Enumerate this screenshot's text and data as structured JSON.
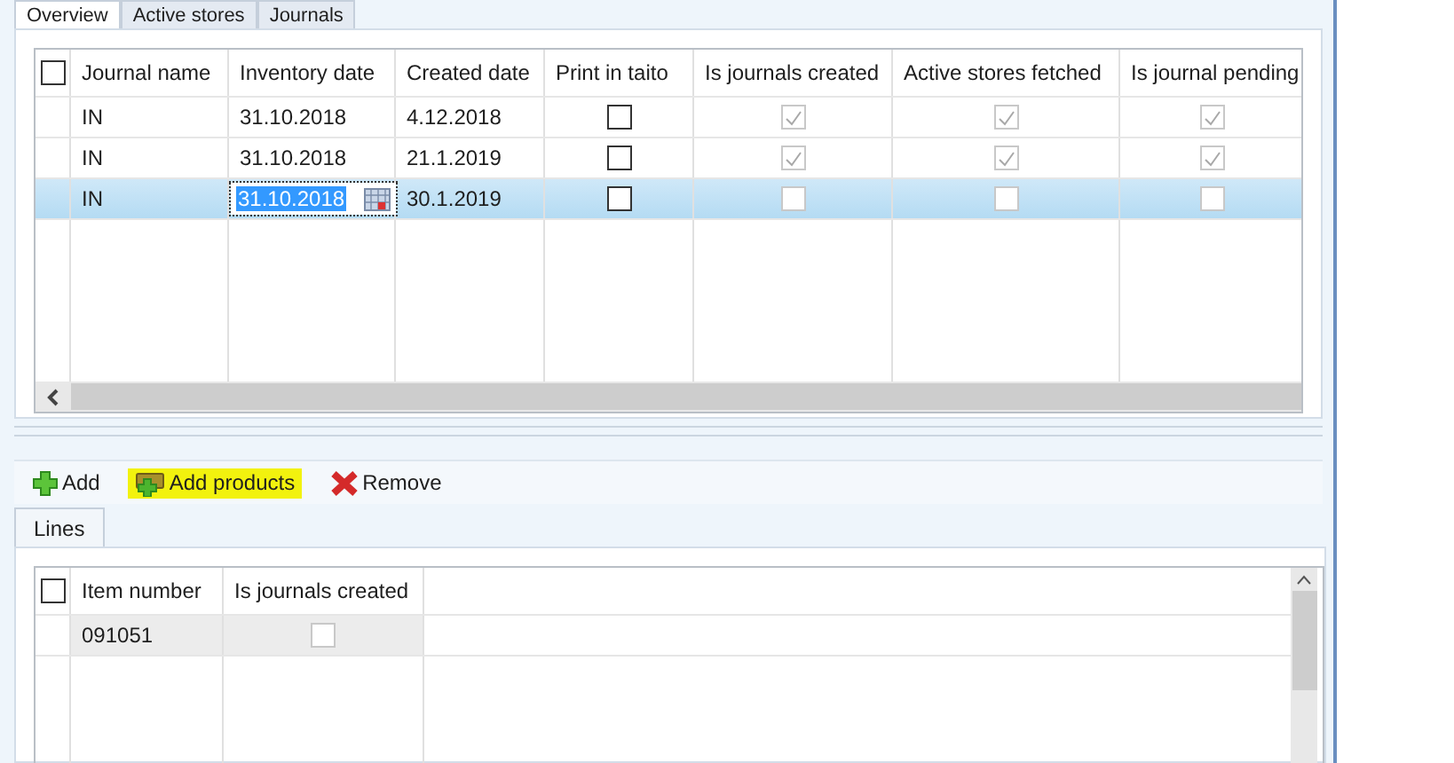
{
  "tabs": [
    {
      "label": "Overview",
      "selected": true
    },
    {
      "label": "Active stores",
      "selected": false
    },
    {
      "label": "Journals",
      "selected": false
    }
  ],
  "top_grid": {
    "select_all_checked": false,
    "columns": [
      {
        "label": "Journal name",
        "kind": "text"
      },
      {
        "label": "Inventory date",
        "kind": "text"
      },
      {
        "label": "Created date",
        "kind": "text"
      },
      {
        "label": "Print in taito",
        "kind": "checkbox"
      },
      {
        "label": "Is journals created",
        "kind": "readonly-checkbox"
      },
      {
        "label": "Active stores fetched",
        "kind": "readonly-checkbox"
      },
      {
        "label": "Is journal pending",
        "kind": "readonly-checkbox"
      }
    ],
    "rows": [
      {
        "selected": false,
        "cells": [
          {
            "text": "IN"
          },
          {
            "text": "31.10.2018"
          },
          {
            "text": "4.12.2018"
          },
          {
            "checked": false
          },
          {
            "checked": true
          },
          {
            "checked": true
          },
          {
            "checked": true
          }
        ]
      },
      {
        "selected": false,
        "cells": [
          {
            "text": "IN"
          },
          {
            "text": "31.10.2018"
          },
          {
            "text": "21.1.2019"
          },
          {
            "checked": false
          },
          {
            "checked": true
          },
          {
            "checked": true
          },
          {
            "checked": true
          }
        ]
      },
      {
        "selected": true,
        "cells": [
          {
            "text": "IN"
          },
          {
            "text": "31.10.2018",
            "editing": true
          },
          {
            "text": "30.1.2019"
          },
          {
            "checked": false
          },
          {
            "checked": false
          },
          {
            "checked": false
          },
          {
            "checked": false
          }
        ]
      }
    ]
  },
  "toolbar": [
    {
      "label": "Add",
      "kind": "add",
      "highlighted": false
    },
    {
      "label": "Add products",
      "kind": "add-products",
      "highlighted": true
    },
    {
      "label": "Remove",
      "kind": "remove",
      "highlighted": false
    }
  ],
  "lines_tabs": [
    {
      "label": "Lines",
      "selected": true
    }
  ],
  "lines_grid": {
    "select_all_checked": false,
    "columns": [
      {
        "label": "Item number",
        "kind": "text"
      },
      {
        "label": "Is journals created",
        "kind": "readonly-checkbox"
      }
    ],
    "rows": [
      {
        "selected": true,
        "cells": [
          {
            "text": "091051"
          },
          {
            "checked": false
          }
        ]
      }
    ]
  }
}
